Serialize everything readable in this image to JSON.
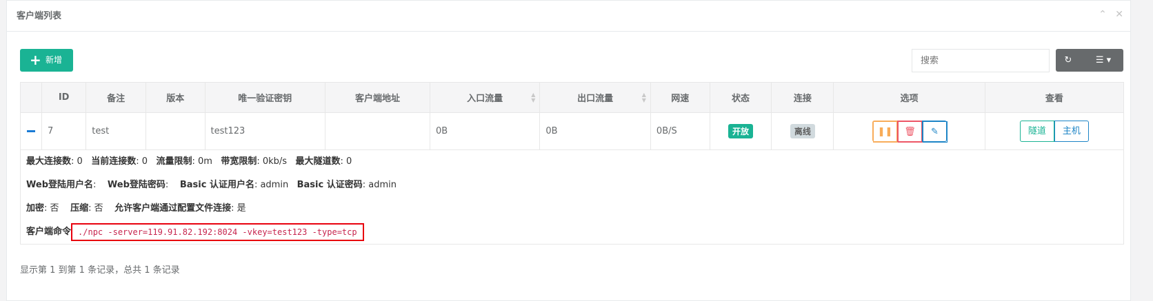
{
  "panel": {
    "title": "客户端列表",
    "collapse_icon": "chevron-up-icon",
    "close_icon": "close-icon"
  },
  "toolbar": {
    "add_label": "新增",
    "search_placeholder": "搜索",
    "refresh_icon": "refresh-icon",
    "columns_icon": "list-columns-icon"
  },
  "colors": {
    "primary": "#1ab394",
    "warning": "#f8ac59",
    "danger": "#ed5565",
    "info": "#1c84c6",
    "highlight_box": "#e8000d"
  },
  "table": {
    "headers": [
      "",
      "ID",
      "备注",
      "版本",
      "唯一验证密钥",
      "客户端地址",
      "入口流量",
      "出口流量",
      "网速",
      "状态",
      "连接",
      "选项",
      "查看"
    ],
    "rows": [
      {
        "id": "7",
        "remark": "test",
        "version": "",
        "vkey": "test123",
        "address": "",
        "in_flow": "0B",
        "out_flow": "0B",
        "speed": "0B/S",
        "status": "开放",
        "connection": "离线",
        "view_tunnel": "隧道",
        "view_host": "主机"
      }
    ]
  },
  "detail": {
    "max_conn_label": "最大连接数",
    "max_conn_value": ": 0",
    "cur_conn_label": "当前连接数",
    "cur_conn_value": ": 0",
    "flow_limit_label": "流量限制",
    "flow_limit_value": ": 0m",
    "bw_limit_label": "带宽限制",
    "bw_limit_value": ": 0kb/s",
    "max_tunnel_label": "最大隧道数",
    "max_tunnel_value": ": 0",
    "web_user_label": "Web登陆用户名",
    "web_user_value": ":",
    "web_pass_label": "Web登陆密码",
    "web_pass_value": ":",
    "basic_user_label": "Basic 认证用户名",
    "basic_user_value": ": admin",
    "basic_pass_label": "Basic 认证密码",
    "basic_pass_value": ": admin",
    "crypt_label": "加密",
    "crypt_value": ": 否",
    "compress_label": "压缩",
    "compress_value": ": 否",
    "allow_conf_label": "允许客户端通过配置文件连接",
    "allow_conf_value": ": 是",
    "cmd_label": "客户端命令",
    "cmd_value": "./npc -server=119.91.82.192:8024 -vkey=test123 -type=tcp"
  },
  "footer": {
    "summary": "显示第 1 到第 1 条记录，总共 1 条记录"
  }
}
